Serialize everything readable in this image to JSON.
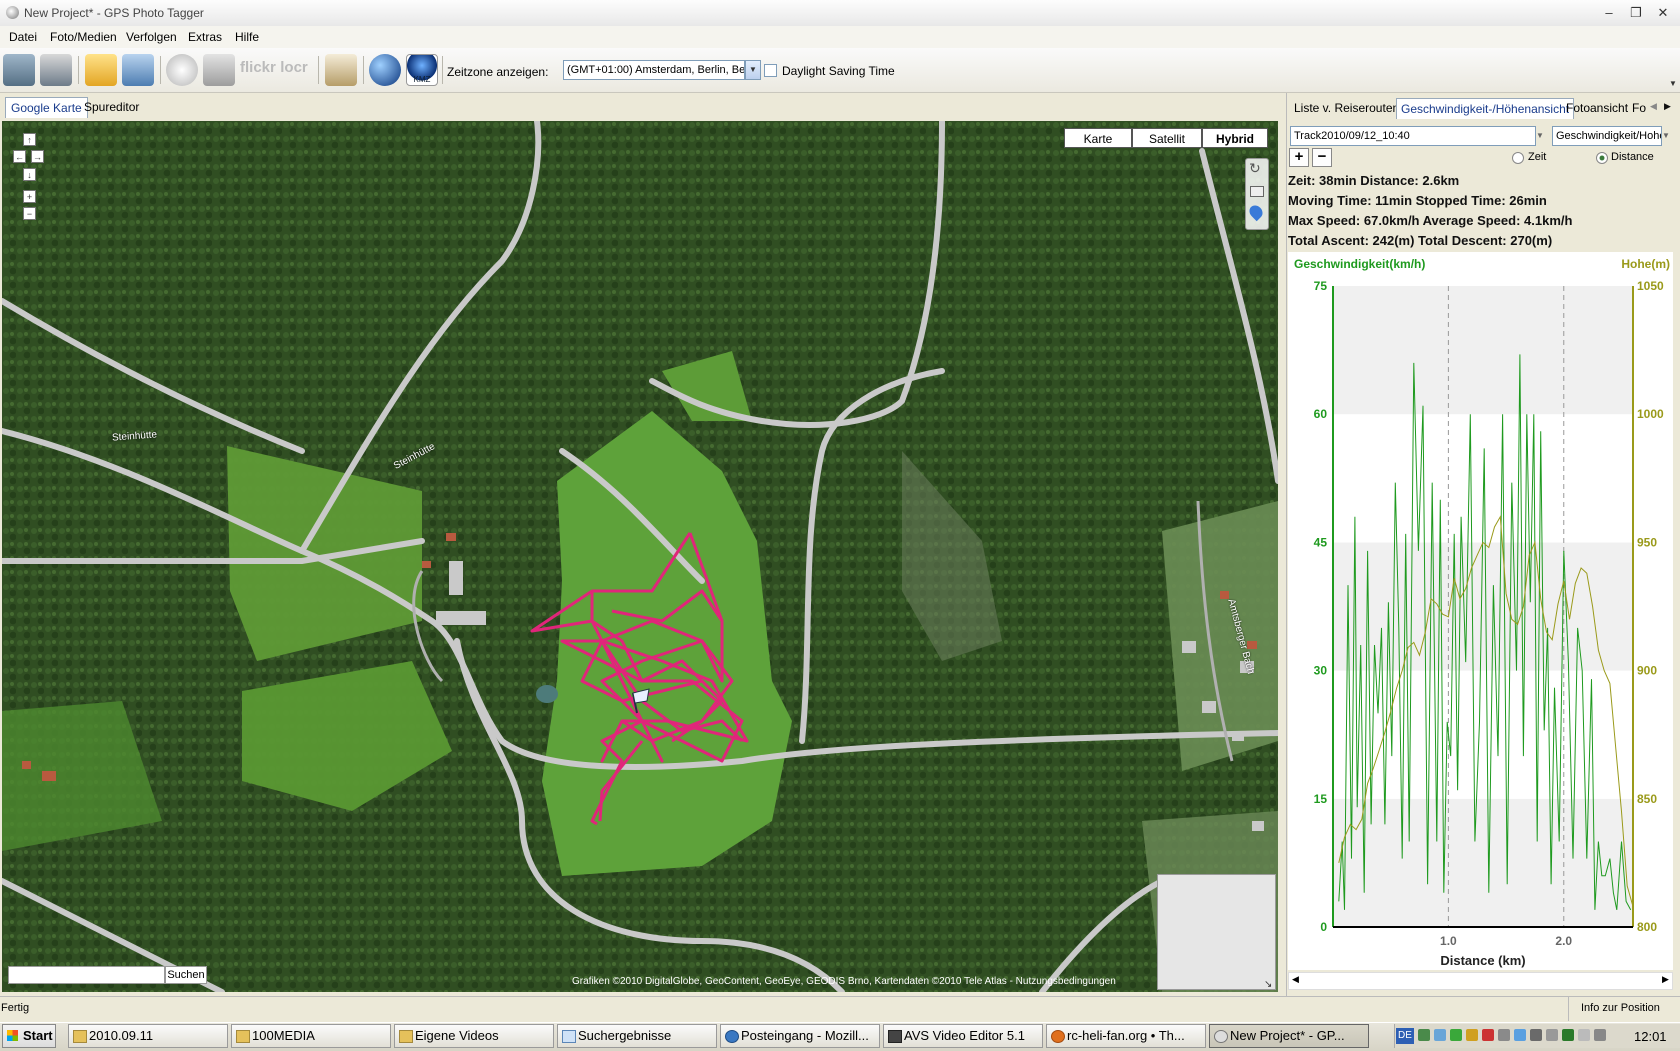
{
  "window": {
    "title": "New Project* - GPS Photo Tagger"
  },
  "menu": [
    "Datei",
    "Foto/Medien",
    "Verfolgen",
    "Extras",
    "Hilfe"
  ],
  "toolbar": {
    "timezone_label": "Zeitzone anzeigen:",
    "timezone_value": "(GMT+01:00) Amsterdam, Berlin, Bern",
    "dst_label": "Daylight Saving Time",
    "icons": [
      "gps-device-icon",
      "download-icon",
      "open-folder-icon",
      "photos-icon",
      "clock-icon",
      "camera-icon",
      "flickr-icon",
      "locr-icon",
      "report-icon",
      "google-earth-icon",
      "kmz-icon"
    ],
    "icon_text": {
      "flickr": "flickr",
      "locr": "locr",
      "kmz": "KMZ"
    }
  },
  "left_tabs": [
    "Google Karte",
    "Spureditor"
  ],
  "map": {
    "type_buttons": [
      "Karte",
      "Satellit",
      "Hybrid"
    ],
    "active_type": "Hybrid",
    "road_labels": [
      "Steinhütte",
      "Steinhütte",
      "Amtsberger Bach"
    ],
    "search_button": "Suchen",
    "copyright": "Grafiken ©2010 DigitalGlobe, GeoContent, GeoEye, GEODIS Brno, Kartendaten ©2010 Tele Atlas - Nutzungsbedingungen",
    "colors": {
      "track": "#e0267a",
      "forest": "#2f4d22",
      "meadow": "#5d9b35",
      "road": "#cfcfcf"
    }
  },
  "right_tabs": [
    "Liste v. Reiserouten",
    "Geschwindigkeit-/Höhenansicht",
    "Fotoansicht",
    "Fo"
  ],
  "right_panel": {
    "track_select": "Track2010/09/12_10:40",
    "view_select": "Geschwindigkeit/Hohe",
    "radio_zeit": "Zeit",
    "radio_distance": "Distance",
    "stats": [
      "Zeit: 38min   Distance: 2.6km",
      "Moving Time: 11min   Stopped Time: 26min",
      "Max Speed: 67.0km/h   Average Speed: 4.1km/h",
      "Total Ascent: 242(m)   Total Descent: 270(m)"
    ]
  },
  "chart_data": {
    "type": "line",
    "xlabel": "Distance (km)",
    "x_ticks": [
      "1.0",
      "2.0"
    ],
    "xlim": [
      0,
      2.6
    ],
    "y_left_label": "Geschwindigkeit(km/h)",
    "y_left_ticks": [
      "0",
      "15",
      "30",
      "45",
      "60",
      "75"
    ],
    "ylim_left": [
      0,
      75
    ],
    "y_right_label": "Hohe(m)",
    "y_right_ticks": [
      "800",
      "850",
      "900",
      "950",
      "1000",
      "1050"
    ],
    "ylim_right": [
      800,
      1050
    ],
    "colors": {
      "speed": "#1f9a1f",
      "height": "#9a9a1a"
    },
    "series": [
      {
        "axis": "left",
        "color": "#1f9a1f",
        "x": [
          0.05,
          0.08,
          0.1,
          0.13,
          0.16,
          0.19,
          0.21,
          0.24,
          0.27,
          0.3,
          0.33,
          0.36,
          0.39,
          0.42,
          0.45,
          0.48,
          0.51,
          0.54,
          0.57,
          0.6,
          0.63,
          0.66,
          0.7,
          0.74,
          0.78,
          0.82,
          0.86,
          0.9,
          0.93,
          0.96,
          0.99,
          1.02,
          1.05,
          1.08,
          1.11,
          1.15,
          1.19,
          1.23,
          1.27,
          1.31,
          1.35,
          1.39,
          1.43,
          1.47,
          1.51,
          1.55,
          1.59,
          1.62,
          1.65,
          1.68,
          1.71,
          1.74,
          1.77,
          1.8,
          1.83,
          1.86,
          1.89,
          1.92,
          1.96,
          2.0,
          2.04,
          2.08,
          2.12,
          2.16,
          2.2,
          2.24,
          2.27,
          2.3,
          2.33,
          2.36,
          2.4,
          2.43,
          2.46,
          2.5,
          2.54,
          2.58
        ],
        "y": [
          3,
          10,
          2,
          40,
          8,
          48,
          14,
          33,
          4,
          44,
          12,
          33,
          25,
          35,
          12,
          38,
          20,
          52,
          35,
          8,
          46,
          10,
          66,
          44,
          61,
          5,
          52,
          10,
          50,
          4,
          24,
          20,
          46,
          16,
          48,
          31,
          60,
          10,
          24,
          56,
          4,
          40,
          20,
          60,
          5,
          52,
          30,
          67,
          20,
          60,
          38,
          60,
          10,
          58,
          23,
          35,
          5,
          28,
          10,
          44,
          31,
          8,
          35,
          30,
          8,
          29,
          2,
          10,
          6,
          6,
          8,
          4,
          2,
          10,
          3,
          2
        ]
      },
      {
        "axis": "right",
        "color": "#9a9a1a",
        "x": [
          0.05,
          0.1,
          0.15,
          0.2,
          0.25,
          0.3,
          0.35,
          0.4,
          0.45,
          0.5,
          0.55,
          0.6,
          0.65,
          0.7,
          0.75,
          0.8,
          0.85,
          0.9,
          0.95,
          1.0,
          1.05,
          1.1,
          1.15,
          1.2,
          1.25,
          1.3,
          1.35,
          1.4,
          1.45,
          1.5,
          1.55,
          1.6,
          1.65,
          1.7,
          1.75,
          1.8,
          1.85,
          1.9,
          1.95,
          2.0,
          2.05,
          2.1,
          2.15,
          2.2,
          2.25,
          2.3,
          2.35,
          2.4,
          2.45,
          2.5,
          2.55,
          2.6
        ],
        "y": [
          825,
          835,
          840,
          838,
          842,
          856,
          862,
          869,
          876,
          884,
          893,
          900,
          909,
          911,
          906,
          915,
          928,
          926,
          922,
          921,
          936,
          928,
          932,
          940,
          945,
          950,
          948,
          956,
          960,
          930,
          920,
          918,
          925,
          945,
          950,
          928,
          915,
          912,
          926,
          935,
          920,
          934,
          940,
          938,
          925,
          908,
          900,
          895,
          870,
          845,
          816,
          808
        ]
      }
    ]
  },
  "statusbar": {
    "left": "Fertig",
    "right": "Info zur Position"
  },
  "taskbar": {
    "start": "Start",
    "tasks": [
      "2010.09.11",
      "100MEDIA",
      "Eigene Videos",
      "Suchergebnisse",
      "Posteingang - Mozill...",
      "AVS Video Editor 5.1",
      "rc-heli-fan.org • Th...",
      "New Project* - GP..."
    ],
    "active_task": "New Project* - GP...",
    "clock": "12:01",
    "lang": "DE"
  }
}
